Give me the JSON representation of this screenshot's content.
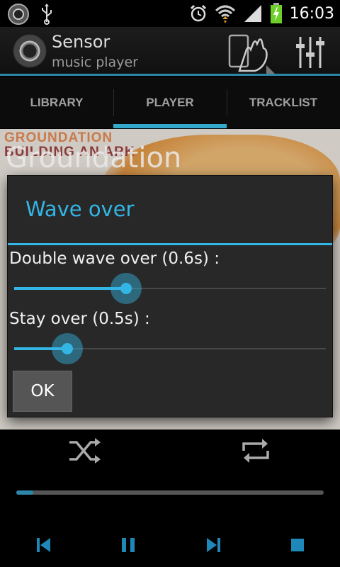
{
  "status_bar": {
    "time": "16:03",
    "left_icons": [
      "app-notification-icon",
      "usb-icon"
    ],
    "right_icons": [
      "alarm-icon",
      "wifi-icon",
      "signal-icon",
      "battery-charging-icon"
    ]
  },
  "action_bar": {
    "title": "Sensor",
    "subtitle": "music player",
    "icons": [
      "wave-hand-icon",
      "equalizer-icon"
    ]
  },
  "tabs": [
    {
      "label": "LIBRARY",
      "active": false
    },
    {
      "label": "PLAYER",
      "active": true
    },
    {
      "label": "TRACKLIST",
      "active": false
    }
  ],
  "album": {
    "art_text_line1": "GROUNDATION",
    "art_text_line2": "BUILDING AN ARK",
    "artist": "Groundation"
  },
  "dialog": {
    "title": "Wave over",
    "settings": [
      {
        "label": "Double wave over (0.6s) :",
        "value_fraction": 0.36
      },
      {
        "label": "Stay over (0.5s) :",
        "value_fraction": 0.17
      }
    ],
    "ok_label": "OK"
  },
  "playback": {
    "progress_fraction": 0.055,
    "controls": [
      "shuffle-icon",
      "repeat-icon",
      "previous-icon",
      "pause-icon",
      "next-icon",
      "stop-icon"
    ]
  },
  "colors": {
    "accent": "#33b5e5",
    "tab_indicator": "#33aacc",
    "control_blue": "#1e88b8"
  }
}
